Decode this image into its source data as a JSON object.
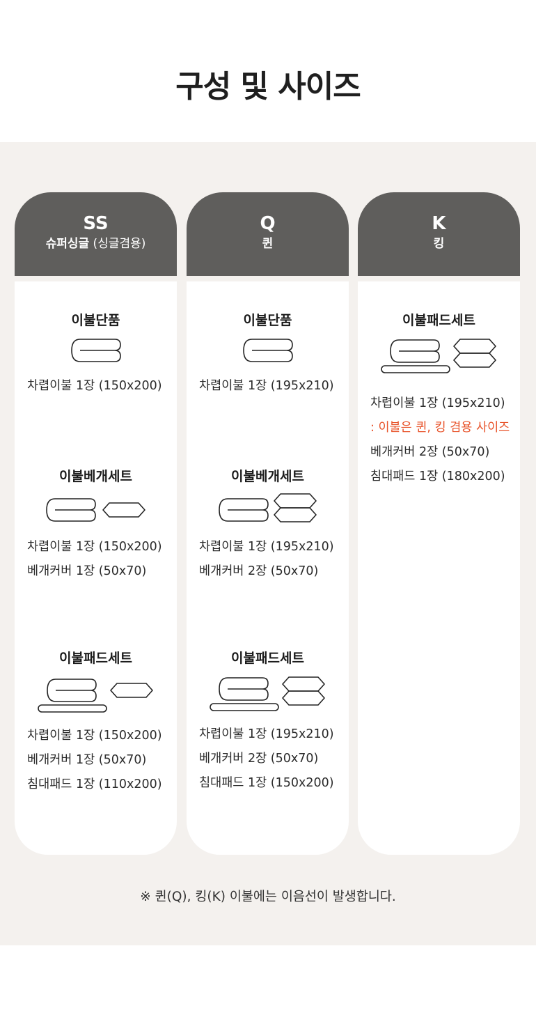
{
  "page_title": "구성 및 사이즈",
  "columns": [
    {
      "code": "SS",
      "sub_bold": "슈퍼싱글",
      "sub_normal": " (싱글겸용)",
      "sets": [
        {
          "title": "이불단품",
          "lines": [
            "차렵이불 1장 (150x200)"
          ]
        },
        {
          "title": "이불베개세트",
          "lines": [
            "차렵이불 1장 (150x200)",
            "베개커버 1장 (50x70)"
          ]
        },
        {
          "title": "이불패드세트",
          "lines": [
            "차렵이불 1장 (150x200)",
            "베개커버 1장 (50x70)",
            "침대패드 1장 (110x200)"
          ]
        }
      ]
    },
    {
      "code": "Q",
      "sub_bold": "퀸",
      "sub_normal": "",
      "sets": [
        {
          "title": "이불단품",
          "lines": [
            "차렵이불 1장 (195x210)"
          ]
        },
        {
          "title": "이불베개세트",
          "lines": [
            "차렵이불 1장 (195x210)",
            "베개커버 2장 (50x70)"
          ]
        },
        {
          "title": "이불패드세트",
          "lines": [
            "차렵이불 1장 (195x210)",
            "베개커버 2장 (50x70)",
            "침대패드 1장 (150x200)"
          ]
        }
      ]
    },
    {
      "code": "K",
      "sub_bold": "킹",
      "sub_normal": "",
      "sets": [
        {
          "title": "이불패드세트",
          "lines": [
            "차렵이불 1장 (195x210)",
            ": 이불은 퀸, 킹 겸용 사이즈",
            "베개커버 2장 (50x70)",
            "침대패드 1장 (180x200)"
          ]
        }
      ]
    }
  ],
  "footnote": "※ 퀸(Q), 킹(K) 이불에는 이음선이 발생합니다.",
  "colors": {
    "header_bg": "#5f5e5c",
    "panel_bg": "#f4f1ee",
    "note": "#e8532a"
  }
}
